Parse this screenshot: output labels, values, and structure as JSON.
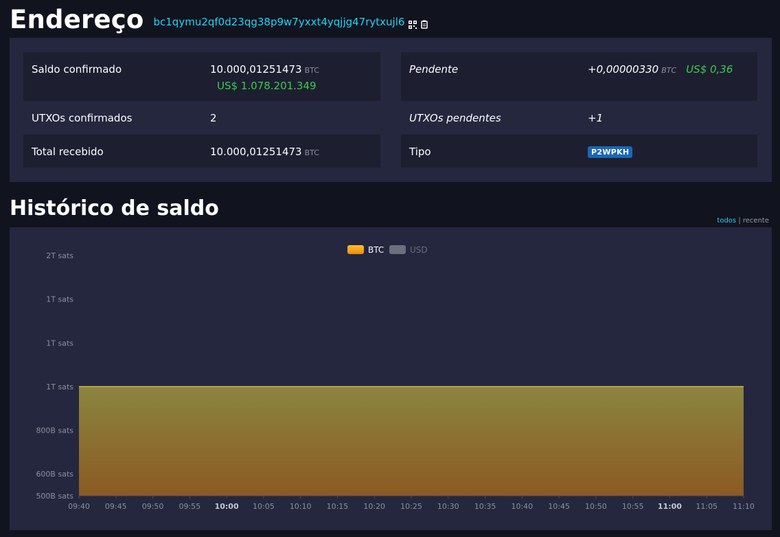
{
  "address": {
    "title": "Endereço",
    "value": "bc1qymu2qf0d23qg38p9w7yxxt4yqjjg47rytxujl6",
    "qr_icon": "qr-code-icon",
    "copy_icon": "copy-icon"
  },
  "summary": {
    "confirmed_label": "Saldo confirmado",
    "confirmed_value": "10.000,01251473",
    "confirmed_unit": "BTC",
    "confirmed_usd": "US$ 1.078.201.349",
    "pending_label": "Pendente",
    "pending_value": "+0,00000330",
    "pending_unit": "BTC",
    "pending_usd": "US$ 0,36",
    "utxos_confirmed_label": "UTXOs confirmados",
    "utxos_confirmed_value": "2",
    "utxos_pending_label": "UTXOs pendentes",
    "utxos_pending_value": "+1",
    "total_received_label": "Total recebido",
    "total_received_value": "10.000,01251473",
    "total_received_unit": "BTC",
    "type_label": "Tipo",
    "type_value": "P2WPKH"
  },
  "history": {
    "title": "Histórico de saldo",
    "toggle_all": "todos",
    "toggle_sep": "|",
    "toggle_recent": "recente"
  },
  "chart_data": {
    "type": "area",
    "legend": [
      {
        "name": "BTC",
        "color": "#f7a51a",
        "active": true
      },
      {
        "name": "USD",
        "color": "#6b6f7e",
        "active": false
      }
    ],
    "legend_position": "top-center",
    "y_ticks": [
      {
        "label": "2T sats",
        "value": 1800000000000
      },
      {
        "label": "1T sats",
        "value": 1600000000000
      },
      {
        "label": "1T sats",
        "value": 1400000000000
      },
      {
        "label": "1T sats",
        "value": 1200000000000
      },
      {
        "label": "800B sats",
        "value": 1000000000000
      },
      {
        "label": "600B sats",
        "value": 800000000000
      },
      {
        "label": "500B sats",
        "value": 700000000000
      }
    ],
    "ylim": [
      700000000000,
      1800000000000
    ],
    "x_ticks": [
      {
        "label": "09:40",
        "bold": false
      },
      {
        "label": "09:45",
        "bold": false
      },
      {
        "label": "09:50",
        "bold": false
      },
      {
        "label": "09:55",
        "bold": false
      },
      {
        "label": "10:00",
        "bold": true
      },
      {
        "label": "10:05",
        "bold": false
      },
      {
        "label": "10:10",
        "bold": false
      },
      {
        "label": "10:15",
        "bold": false
      },
      {
        "label": "10:20",
        "bold": false
      },
      {
        "label": "10:25",
        "bold": false
      },
      {
        "label": "10:30",
        "bold": false
      },
      {
        "label": "10:35",
        "bold": false
      },
      {
        "label": "10:40",
        "bold": false
      },
      {
        "label": "10:45",
        "bold": false
      },
      {
        "label": "10:50",
        "bold": false
      },
      {
        "label": "10:55",
        "bold": false
      },
      {
        "label": "11:00",
        "bold": true
      },
      {
        "label": "11:05",
        "bold": false
      },
      {
        "label": "11:10",
        "bold": false
      }
    ],
    "series": [
      {
        "name": "BTC",
        "x": [
          "09:40",
          "11:10"
        ],
        "values": [
          1200001251473,
          1200001251473
        ]
      }
    ],
    "grid": false
  }
}
